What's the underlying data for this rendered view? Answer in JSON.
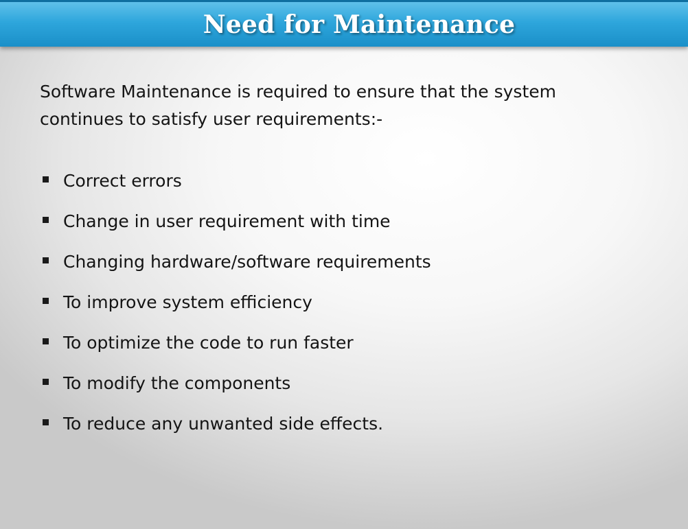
{
  "slide": {
    "title": "Need for Maintenance",
    "intro": "Software Maintenance is required to ensure that the system continues to satisfy user requirements:-",
    "bullets": [
      "Correct errors",
      "Change in user requirement with time",
      "Changing hardware/software requirements",
      "To improve system efficiency",
      "To optimize the code to run faster",
      "To modify the components",
      "To reduce any unwanted side effects."
    ]
  },
  "colors": {
    "title_bar": "#2ea6dc",
    "title_text": "#ffffff",
    "body_text": "#141414",
    "bullet": "#1a1a1a"
  },
  "icons": {
    "bullet": "square-bullet-icon"
  }
}
